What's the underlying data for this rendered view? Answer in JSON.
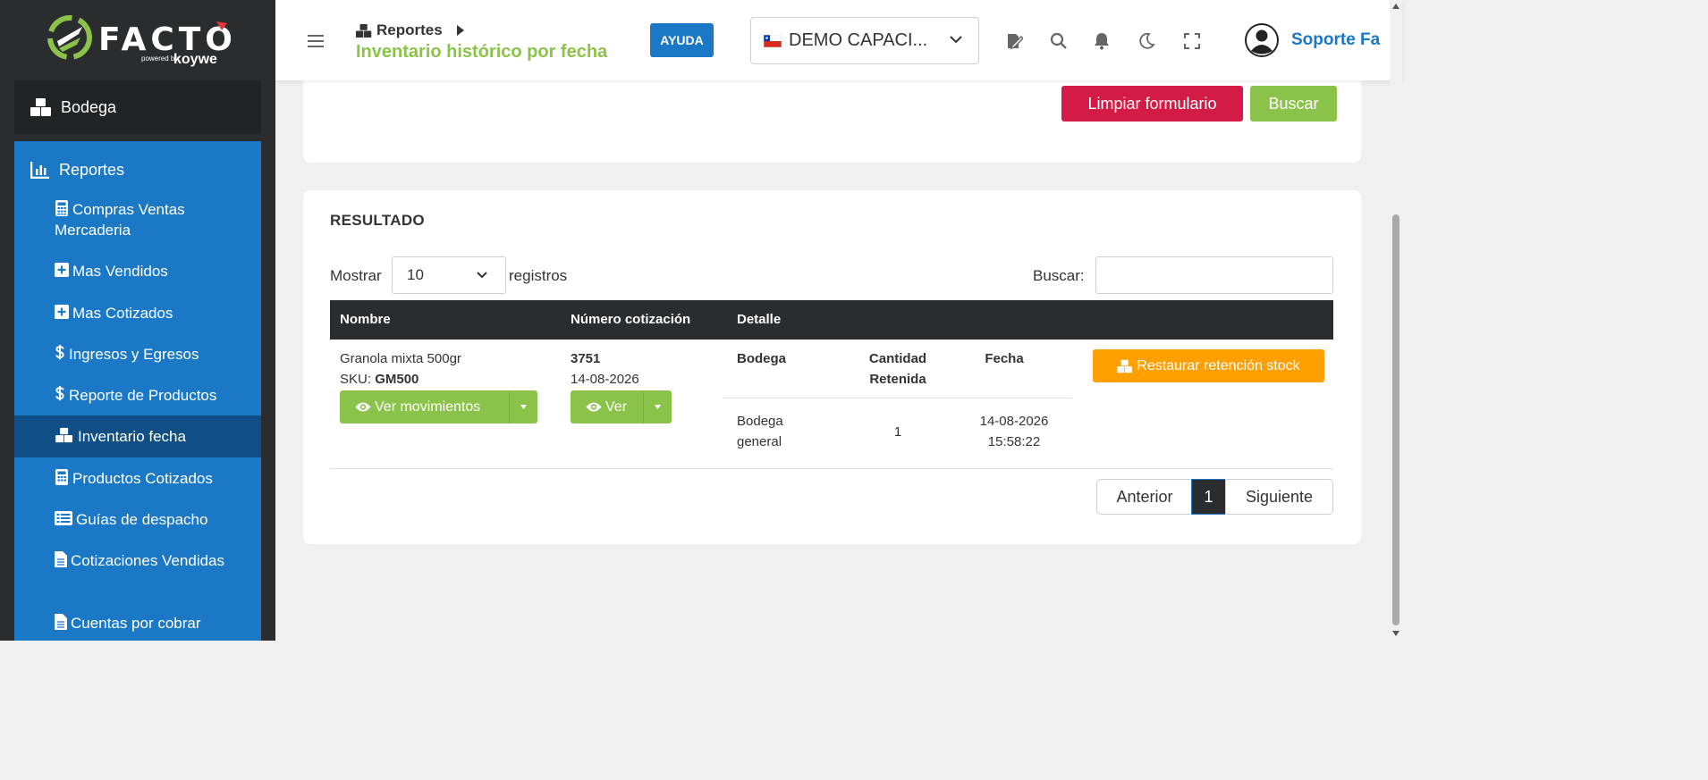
{
  "brand": {
    "name": "FACTO",
    "powered": "powered by",
    "partner": "koywe",
    "colors": {
      "primary": "#1a78c7",
      "accent": "#8bc34a",
      "danger": "#d41b45",
      "warning": "#ffa000",
      "dark": "#2b2c2e"
    }
  },
  "sidebar": {
    "top_item": {
      "label": "Bodega",
      "icon": "cubes-icon"
    },
    "section": {
      "label": "Reportes",
      "icon": "bar-chart-icon"
    },
    "items": [
      {
        "label": "Compras Ventas Mercaderia",
        "icon": "calculator-icon",
        "active": false
      },
      {
        "label": "Mas Vendidos",
        "icon": "plus-square-icon",
        "active": false
      },
      {
        "label": "Mas Cotizados",
        "icon": "plus-square-icon",
        "active": false
      },
      {
        "label": "Ingresos y Egresos",
        "icon": "dollar-icon",
        "active": false
      },
      {
        "label": "Reporte de Productos",
        "icon": "dollar-icon",
        "active": false
      },
      {
        "label": "Inventario fecha",
        "icon": "cubes-icon",
        "active": true
      },
      {
        "label": "Productos Cotizados",
        "icon": "calculator-icon",
        "active": false
      },
      {
        "label": "Guías de despacho",
        "icon": "list-icon",
        "active": false
      },
      {
        "label": "Cotizaciones Vendidas",
        "icon": "file-icon",
        "active": false
      },
      {
        "label": "Cuentas por cobrar",
        "icon": "file-icon",
        "active": false
      }
    ]
  },
  "header": {
    "breadcrumb": "Reportes",
    "title": "Inventario histórico por fecha",
    "help_label": "AYUDA",
    "company": "DEMO CAPACI...",
    "user": "Soporte Fa"
  },
  "filters": {
    "clear_label": "Limpiar formulario",
    "search_label": "Buscar"
  },
  "result": {
    "title": "RESULTADO",
    "show_label": "Mostrar",
    "page_size": "10",
    "records_label": "registros",
    "search_label": "Buscar:",
    "search_value": "",
    "columns": [
      "Nombre",
      "Número cotización",
      "Detalle"
    ],
    "rows": [
      {
        "name": "Granola mixta 500gr",
        "sku_label": "SKU:",
        "sku": "GM500",
        "movements_label": "Ver movimientos",
        "quote_number": "3751",
        "quote_date": "14-08-2026",
        "view_label": "Ver",
        "detail_headers": [
          "Bodega",
          "Cantidad Retenida",
          "Fecha"
        ],
        "detail": {
          "warehouse": "Bodega general",
          "qty": "1",
          "date": "14-08-2026",
          "time": "15:58:22"
        },
        "restore_label": "Restaurar retención stock"
      }
    ],
    "pagination": {
      "prev": "Anterior",
      "current": "1",
      "next": "Siguiente"
    }
  }
}
